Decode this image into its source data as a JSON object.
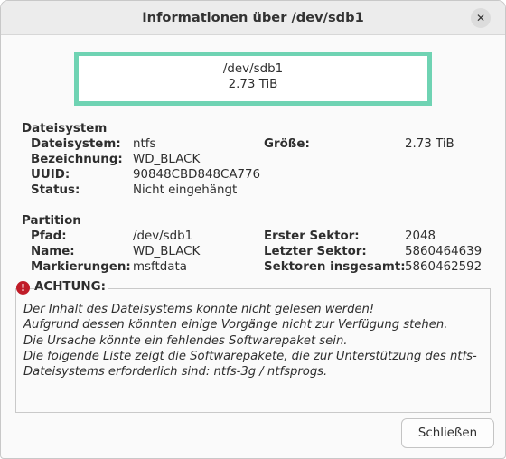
{
  "window": {
    "title": "Informationen über /dev/sdb1",
    "close_icon": "close-icon"
  },
  "device": {
    "path": "/dev/sdb1",
    "size": "2.73 TiB",
    "color": "#6fd3b3"
  },
  "filesystem": {
    "heading": "Dateisystem",
    "fs_label": "Dateisystem:",
    "fs_value": "ntfs",
    "size_label": "Größe:",
    "size_value": "2.73 TiB",
    "name_label": "Bezeichnung:",
    "name_value": "WD_BLACK",
    "uuid_label": "UUID:",
    "uuid_value": "90848CBD848CA776",
    "status_label": "Status:",
    "status_value": "Nicht eingehängt"
  },
  "partition": {
    "heading": "Partition",
    "path_label": "Pfad:",
    "path_value": "/dev/sdb1",
    "first_label": "Erster Sektor:",
    "first_value": "2048",
    "name_label": "Name:",
    "name_value": "WD_BLACK",
    "last_label": "Letzter Sektor:",
    "last_value": "5860464639",
    "flags_label": "Markierungen:",
    "flags_value": "msftdata",
    "total_label": "Sektoren insgesamt:",
    "total_value": "5860462592"
  },
  "warning": {
    "icon": "error-icon",
    "title": "ACHTUNG:",
    "lines": [
      "Der Inhalt des Dateisystems konnte nicht gelesen werden!",
      "Aufgrund dessen könnten einige Vorgänge nicht zur Verfügung stehen.",
      "Die Ursache könnte ein fehlendes Softwarepaket sein.",
      "Die folgende Liste zeigt die Softwarepakete, die zur Unterstützung des ntfs-",
      "Dateisystems erforderlich sind: ntfs-3g / ntfsprogs."
    ]
  },
  "buttons": {
    "close_label": "Schließen"
  }
}
